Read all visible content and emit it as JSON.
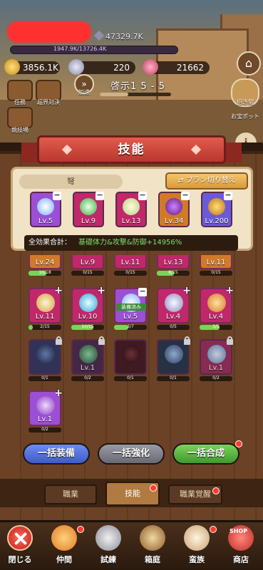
{
  "hud": {
    "power": "47329.7K",
    "hp_text": "1947.9K/13726.4K",
    "gold": "3856.1K",
    "silver": "220",
    "gem": "21662",
    "stage": "啓示1 5 - 5",
    "left_buttons": [
      "任務",
      "超界対決",
      "競技場"
    ],
    "accel_label": "加速",
    "cat_label": "招き猫",
    "reserve_label": "お宝ポット"
  },
  "panel": {
    "title": "技能",
    "category": "弩",
    "plan_button": "プラン切り替え",
    "total_label": "全効果合計：",
    "total_value": "基礎体力&攻撃&防御+14956%"
  },
  "equipped": [
    {
      "lv": "Lv.5",
      "color": "#9b4fd4",
      "glyph": "#e8f4ff"
    },
    {
      "lv": "Lv.9",
      "color": "#c0286a",
      "glyph": "#7ee07a"
    },
    {
      "lv": "Lv.13",
      "color": "#c0286a",
      "glyph": "#f4f0c8"
    },
    {
      "lv": "Lv.34",
      "color": "#d07a2a",
      "glyph": "#8a2ab0"
    },
    {
      "lv": "Lv.200",
      "color": "#6a5ad8",
      "glyph": "#f0b040"
    }
  ],
  "skills_row0": [
    "Lv.24",
    "Lv.9",
    "Lv.11",
    "Lv.13",
    "Lv.11"
  ],
  "skills_row0_prog": [
    "10/18",
    "0/15",
    "0/15",
    "8/15",
    "0/15"
  ],
  "skills_row1": [
    {
      "lv": "Lv.11",
      "prog": "2/15",
      "fill": 0.13,
      "badge": "plus"
    },
    {
      "lv": "Lv.10",
      "prog": "10/15",
      "fill": 0.67,
      "badge": "plus"
    },
    {
      "lv": "Lv.5",
      "prog": "3/7",
      "fill": 0.43,
      "badge": "minus",
      "tag": "装備済み"
    },
    {
      "lv": "Lv.4",
      "prog": "0/5",
      "fill": 0.0,
      "badge": "plus"
    },
    {
      "lv": "Lv.4",
      "prog": "3/5",
      "fill": 0.6,
      "badge": "plus"
    }
  ],
  "skills_row2": [
    {
      "lv": "",
      "prog": "0/1",
      "badge": "lock"
    },
    {
      "lv": "Lv.1",
      "prog": "0/2",
      "badge": "lock"
    },
    {
      "lv": "",
      "prog": "0/1",
      "badge": "none"
    },
    {
      "lv": "",
      "prog": "0/1",
      "badge": "lock"
    },
    {
      "lv": "Lv.1",
      "prog": "0/2",
      "badge": "lock"
    }
  ],
  "skills_row3": [
    {
      "lv": "Lv.1",
      "prog": "0/2",
      "badge": "plus"
    }
  ],
  "actions": {
    "equip_all": "一括装備",
    "enhance_all": "一括強化",
    "combine_all": "一括合成"
  },
  "tabs": [
    "職業",
    "技能",
    "職業覚醒"
  ],
  "nav": [
    "閉じる",
    "仲間",
    "試練",
    "箱庭",
    "蛮族",
    "商店"
  ],
  "shop_badge": "SHOP"
}
